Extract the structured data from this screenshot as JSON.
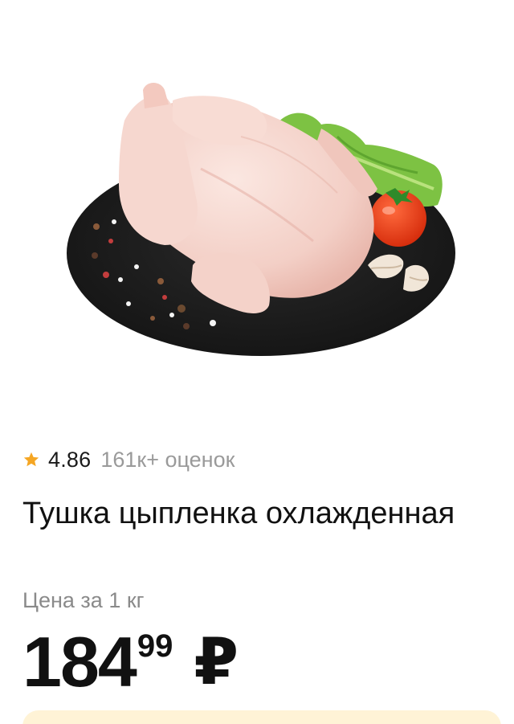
{
  "product": {
    "image_alt": "Тушка цыпленка на черной подставке",
    "rating": {
      "value": "4.86",
      "count": "161к+ оценок",
      "icon": "star-icon",
      "star_color": "#f5a623"
    },
    "title": "Тушка цыпленка охлажденная",
    "price_label": "Цена за 1 кг",
    "price": {
      "integer": "184",
      "fraction": "99",
      "currency": "₽"
    }
  },
  "colors": {
    "background": "#ffffff",
    "text_primary": "#111111",
    "text_secondary": "#8a8a8a",
    "promo_background": "#fff3d6"
  }
}
